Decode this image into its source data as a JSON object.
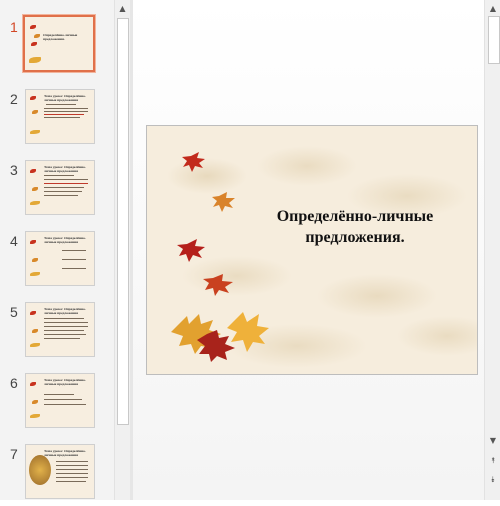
{
  "slides": [
    {
      "num": "1",
      "title": "Определённо-личные предложения."
    },
    {
      "num": "2",
      "title": "Тема урока: Определённо-личные предложения"
    },
    {
      "num": "3",
      "title": "Тема урока: Определённо-личные предложения"
    },
    {
      "num": "4",
      "title": "Тема урока: Определённо-личные предложения"
    },
    {
      "num": "5",
      "title": "Тема урока: Определённо-личные предложения"
    },
    {
      "num": "6",
      "title": "Тема урока: Определённо-личные предложения"
    },
    {
      "num": "7",
      "title": "Тема урока: Определённо-личные предложения"
    }
  ],
  "main_slide": {
    "title": "Определённо-личные предложения."
  },
  "colors": {
    "selected_border": "#e0704a",
    "selected_number": "#d24726",
    "slide_bg": "#f6eddd"
  },
  "icons": {
    "scroll_up": "▲",
    "scroll_down": "▼",
    "prev_slide": "⯭",
    "next_slide": "⯯"
  }
}
